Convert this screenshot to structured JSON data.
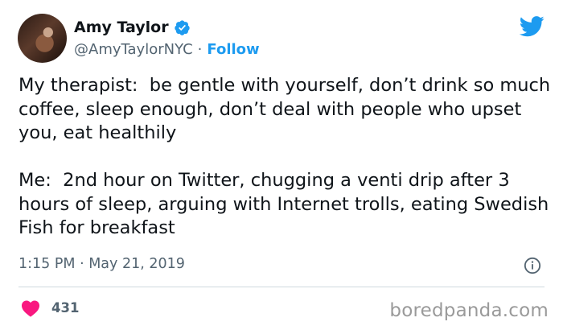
{
  "author": {
    "name": "Amy Taylor",
    "handle": "@AmyTaylorNYC",
    "follow_label": "Follow",
    "verified": true
  },
  "tweet": {
    "paragraph_1": "My therapist:  be gentle with yourself, don’t drink so much coffee, sleep enough, don’t deal with people who upset you, eat healthily",
    "paragraph_2": "Me:  2nd hour on Twitter, chugging a venti drip after 3 hours of sleep, arguing with Internet trolls, eating Swedish Fish for breakfast",
    "timestamp": "1:15 PM · May 21, 2019"
  },
  "engagement": {
    "like_count": "431"
  },
  "watermark": "boredpanda.com",
  "icons": {
    "verified": "verified-badge-icon",
    "platform": "twitter-bird-icon",
    "info": "info-icon",
    "like": "heart-icon"
  },
  "colors": {
    "accent": "#1d9bf0",
    "like": "#f91880",
    "secondary_text": "#536471",
    "divider": "#cfd9de"
  }
}
